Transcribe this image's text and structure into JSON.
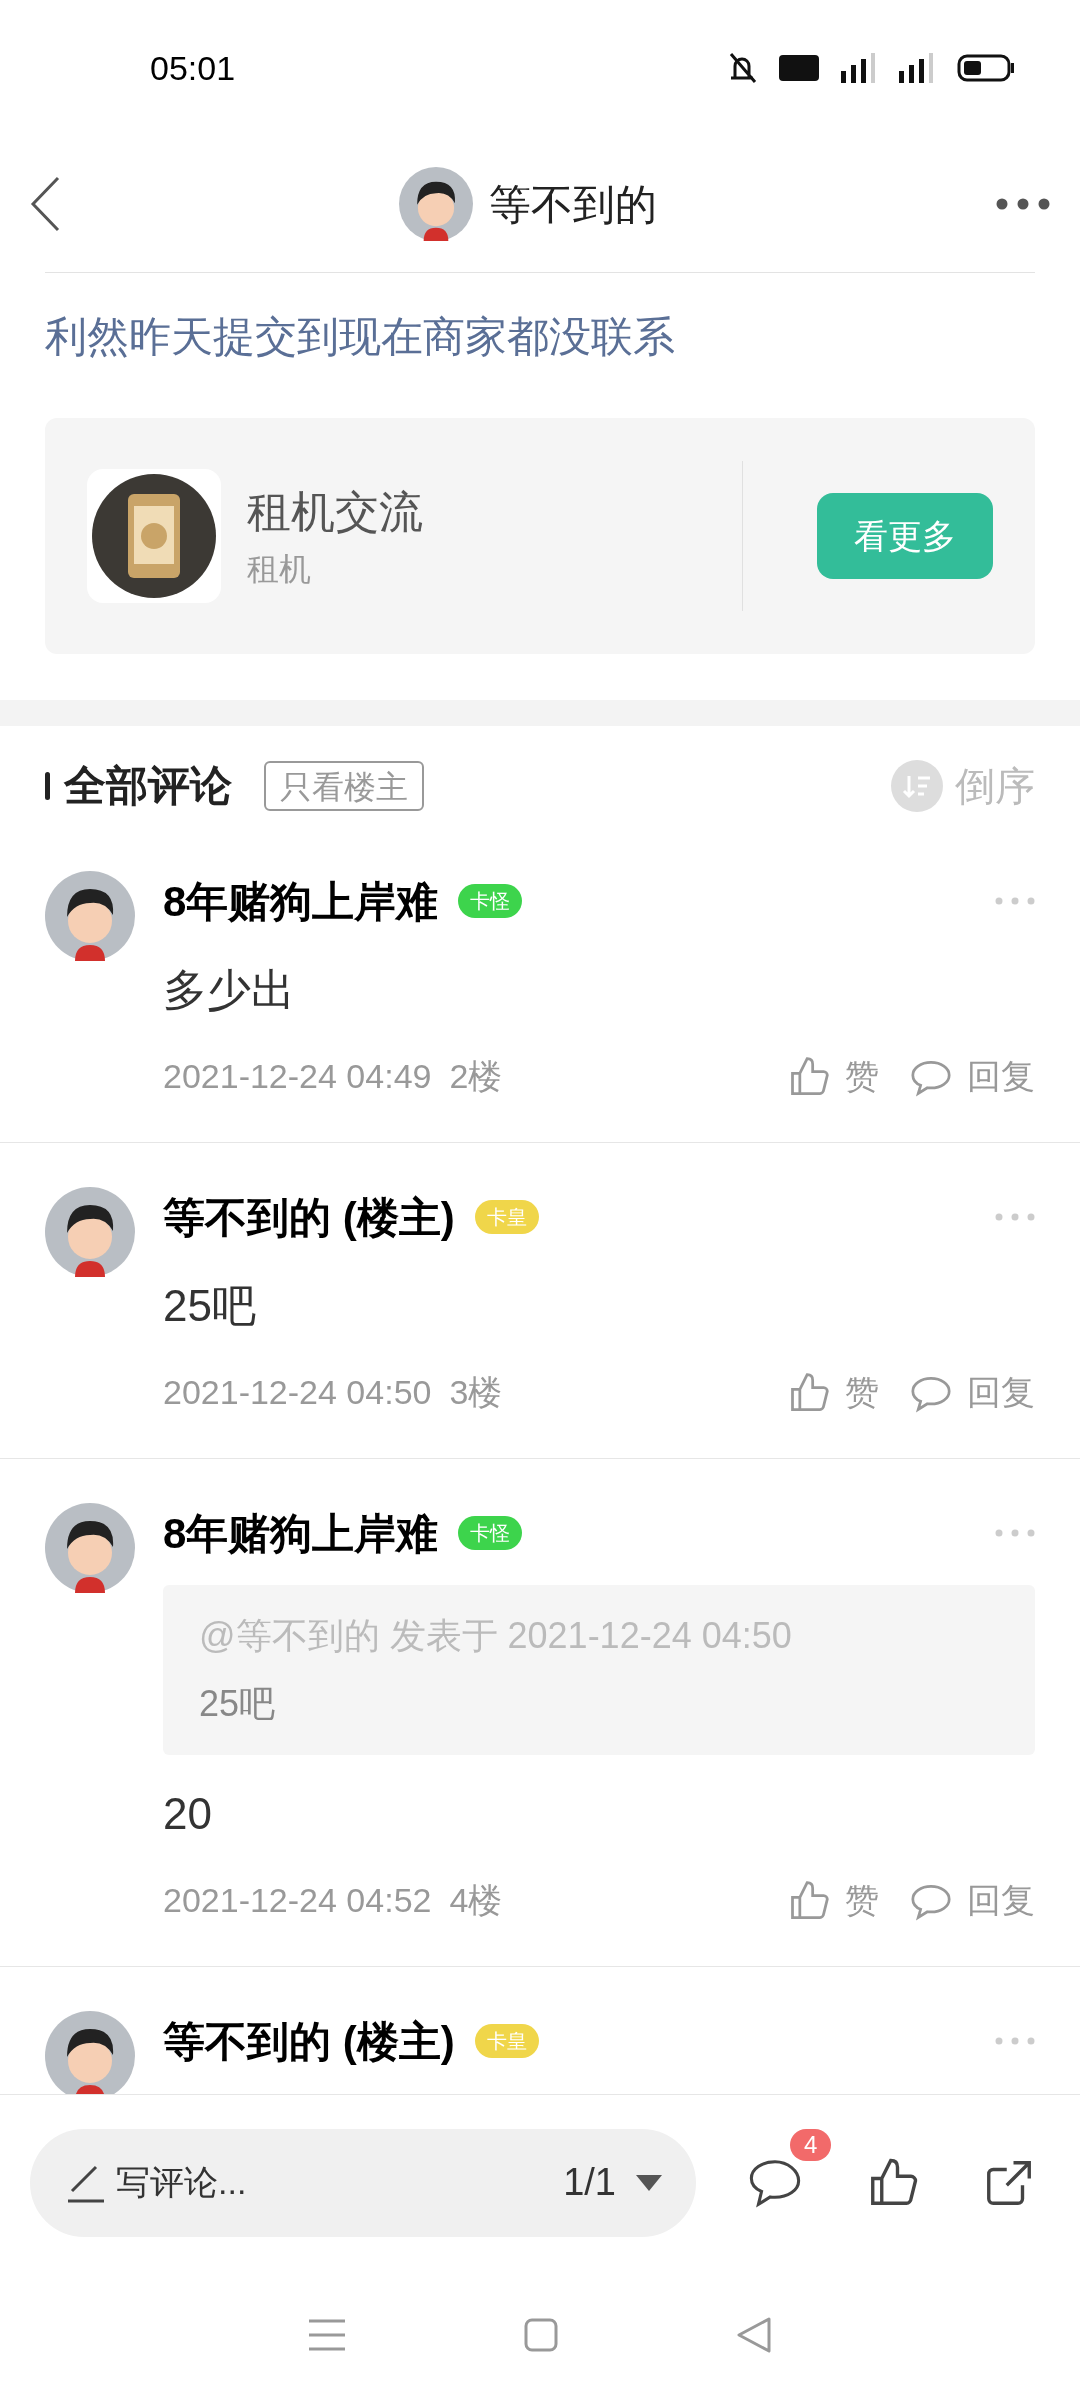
{
  "status_bar": {
    "time": "05:01"
  },
  "header": {
    "title": "等不到的"
  },
  "post": {
    "title": "利然昨天提交到现在商家都没联系"
  },
  "forum_card": {
    "name": "租机交流",
    "subtitle": "租机",
    "button": "看更多"
  },
  "comments_header": {
    "title": "全部评论",
    "filter": {
      "label": "只看楼主",
      "selected": false
    },
    "sort": "倒序"
  },
  "comments": [
    {
      "name": "8年赌狗上岸难",
      "badge": {
        "text": "卡怪",
        "color": "#3dd44c"
      },
      "content": "多少出",
      "time": "2021-12-24 04:49",
      "floor": "2楼",
      "like": "赞",
      "reply": "回复"
    },
    {
      "name": "等不到的 (楼主)",
      "badge": {
        "text": "卡皇",
        "color": "#f0d64a"
      },
      "content": "25吧",
      "time": "2021-12-24 04:50",
      "floor": "3楼",
      "like": "赞",
      "reply": "回复"
    },
    {
      "name": "8年赌狗上岸难",
      "badge": {
        "text": "卡怪",
        "color": "#3dd44c"
      },
      "quote": {
        "meta": "@等不到的 发表于 2021-12-24 04:50",
        "text": "25吧"
      },
      "content": "20",
      "time": "2021-12-24 04:52",
      "floor": "4楼",
      "like": "赞",
      "reply": "回复"
    },
    {
      "name": "等不到的 (楼主)",
      "badge": {
        "text": "卡皇",
        "color": "#f0d64a"
      }
    }
  ],
  "bottom_bar": {
    "placeholder": "写评论...",
    "page": "1/1",
    "comment_count": "4"
  }
}
